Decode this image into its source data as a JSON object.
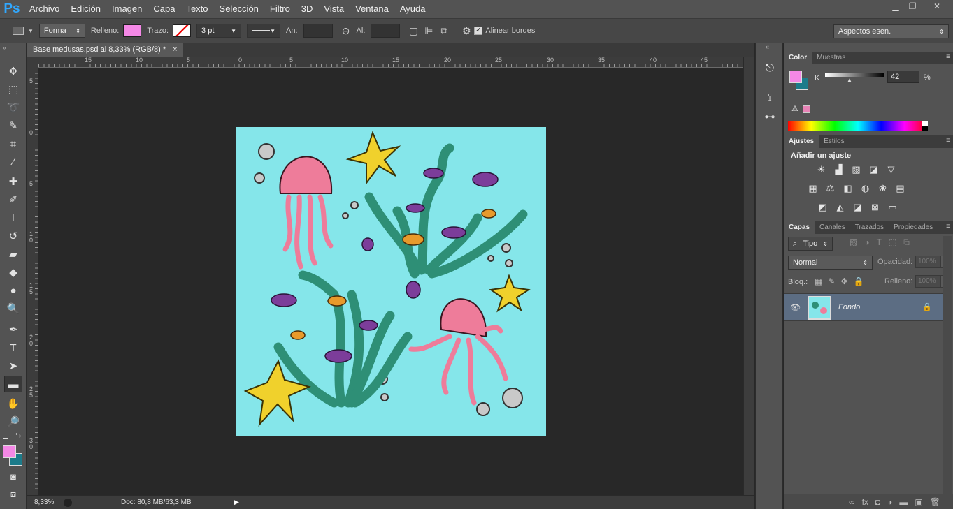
{
  "app": {
    "logo": "Ps"
  },
  "menu": [
    "Archivo",
    "Edición",
    "Imagen",
    "Capa",
    "Texto",
    "Selección",
    "Filtro",
    "3D",
    "Vista",
    "Ventana",
    "Ayuda"
  ],
  "window_controls": {
    "minimize": "▁",
    "restore": "❐",
    "close": "✕"
  },
  "options": {
    "mode": "Forma",
    "fill_label": "Relleno:",
    "fill_color": "#f488e6",
    "stroke_label": "Trazo:",
    "stroke_width": "3 pt",
    "width_label": "An:",
    "height_label": "Al:",
    "align_edges": "Alinear bordes",
    "align_checked": "✓",
    "workspace": "Aspectos esen."
  },
  "document": {
    "tab_title": "Base medusas.psd al 8,33% (RGB/8) *",
    "tab_close": "×",
    "zoom": "8,33%",
    "doc_info": "Doc: 80,8 MB/63,3 MB",
    "status_arrow": "▶"
  },
  "rulers": {
    "h": [
      "15",
      "10",
      "5",
      "0",
      "5",
      "10",
      "15",
      "20",
      "25",
      "30",
      "35",
      "40",
      "45"
    ],
    "v": [
      "5",
      "0",
      "5",
      "1 0",
      "1 5",
      "2 0",
      "2 5",
      "3 0"
    ]
  },
  "colors": {
    "foreground": "#f488e6",
    "background": "#1c7b8a",
    "canvas": "#85e6ea"
  },
  "color_panel": {
    "tabs": [
      "Color",
      "Muestras"
    ],
    "channel": "K",
    "value": "42",
    "unit": "%",
    "warning_icon": "⚠"
  },
  "adjustments_panel": {
    "tabs": [
      "Ajustes",
      "Estilos"
    ],
    "title": "Añadir un ajuste",
    "rows": [
      [
        "☀",
        "▟",
        "▨",
        "◪",
        "▽"
      ],
      [
        "▦",
        "⚖",
        "◧",
        "◍",
        "❀",
        "▤"
      ],
      [
        "◩",
        "◭",
        "◪",
        "⊠",
        "▭"
      ]
    ]
  },
  "layers_panel": {
    "tabs": [
      "Capas",
      "Canales",
      "Trazados",
      "Propiedades"
    ],
    "filter": "Tipo",
    "blend_mode": "Normal",
    "opacity_label": "Opacidad:",
    "opacity_value": "100%",
    "lock_label": "Bloq.:",
    "fill_label": "Relleno:",
    "fill_value": "100%",
    "layers": [
      {
        "name": "Fondo",
        "visible": true,
        "locked": true
      }
    ],
    "bottom_icons": [
      "∞",
      "fx",
      "◘",
      "◑",
      "▬",
      "▣",
      "🗑"
    ]
  },
  "icons": {
    "eye": "👁",
    "lock": "🔒",
    "collapse": "«"
  }
}
